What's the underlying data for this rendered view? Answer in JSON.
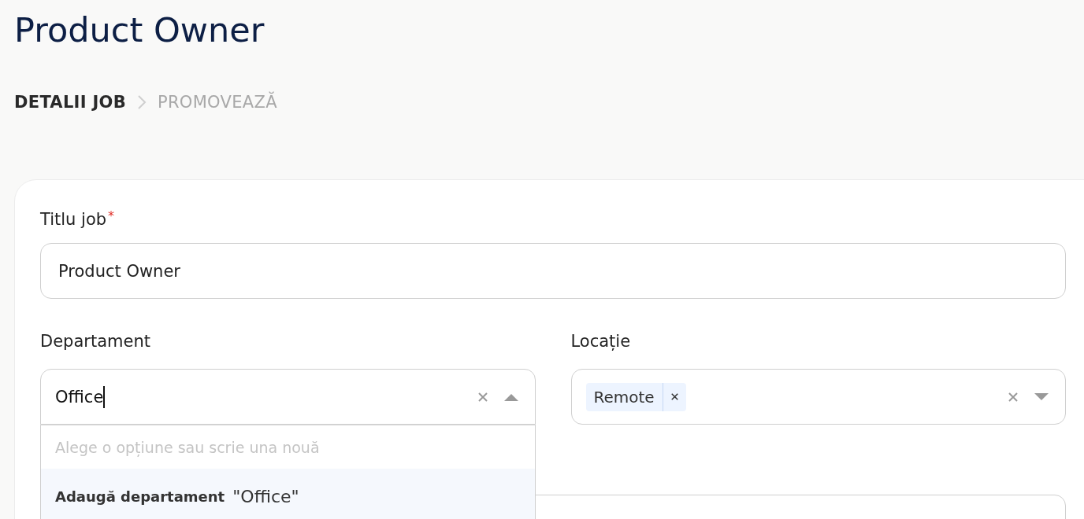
{
  "page_title": "Product Owner",
  "steps": [
    {
      "label": "DETALII JOB",
      "selected": true
    },
    {
      "label": "PROMOVEAZĂ",
      "selected": false
    }
  ],
  "form": {
    "title_field": {
      "label": "Titlu job",
      "required_mark": "*",
      "value": "Product Owner"
    },
    "department": {
      "label": "Departament",
      "value": "Office",
      "expanded": true,
      "menu": {
        "hint": "Alege o opțiune sau scrie una nouă",
        "create_option": {
          "prefix": "Adaugă departament",
          "value": "\"Office\"",
          "selected": true
        }
      }
    },
    "location": {
      "label": "Locație",
      "expanded": false,
      "tags": [
        "Remote"
      ]
    }
  }
}
